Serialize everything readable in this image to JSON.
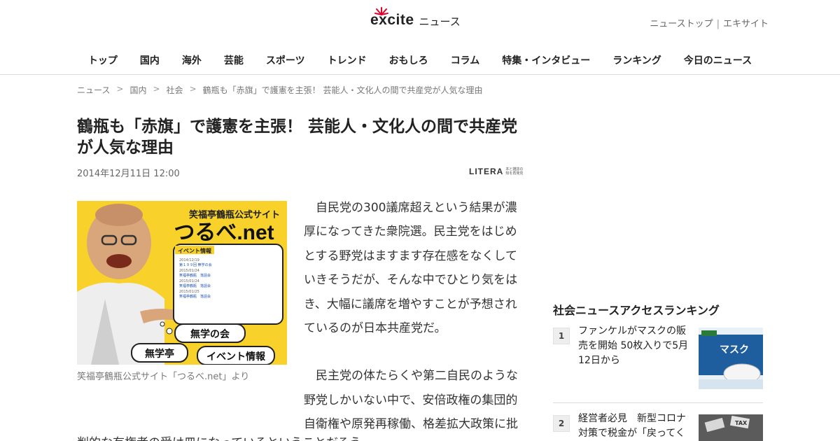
{
  "header": {
    "logo_text": "excite",
    "logo_suffix": "ニュース",
    "links": [
      "ニューストップ",
      "エキサイト"
    ],
    "link_separator": "|"
  },
  "nav": {
    "items": [
      "トップ",
      "国内",
      "海外",
      "芸能",
      "スポーツ",
      "トレンド",
      "おもしろ",
      "コラム",
      "特集・インタビュー",
      "ランキング",
      "今日のニュース"
    ]
  },
  "breadcrumb": {
    "items": [
      "ニュース",
      "国内",
      "社会",
      "鶴瓶も「赤旗」で護憲を主張！ 芸能人・文化人の間で共産党が人気な理由"
    ],
    "separator": ">"
  },
  "article": {
    "title": "鶴瓶も「赤旗」で護憲を主張！ 芸能人・文化人の間で共産党が人気な理由",
    "date": "2014年12月11日 12:00",
    "source": "LITERA",
    "source_tagline": "本と雑誌の知を再発見",
    "image": {
      "site_name": "笑福亭鶴瓶公式サイト",
      "site_title": "つるべ.net",
      "panel_label": "イベント情報",
      "events": [
        {
          "date": "2014/12/19",
          "name": "第１９９回 無学の会"
        },
        {
          "date": "2015/01/24",
          "name": "笑福亭鶴瓶　落語会"
        },
        {
          "date": "2015/01/24",
          "name": "笑福亭鶴瓶　落語会"
        },
        {
          "date": "2015/01/25",
          "name": "笑福亭鶴瓶　落語会"
        }
      ],
      "bubbles": [
        "無学の会",
        "無学亭",
        "イベント情報"
      ]
    },
    "caption": "笑福亭鶴瓶公式サイト「つるべ.net」より",
    "paragraphs": [
      "自民党の300議席超えという結果が濃厚になってきた衆院選。民主党をはじめとする野党はますます存在感をなくしていきそうだが、そんな中でひとり気をはき、大幅に議席を増やすことが予想されているのが日本共産党だ。",
      "民主党の体たらくや第二自民のような野党しかいない中で、安倍政権の集団的自衛権や原発再稼働、格差拡大政策に批"
    ],
    "cutoff_line": "判的な有権者の受け皿になっているということだろう。"
  },
  "sidebar": {
    "ranking_title": "社会ニュースアクセスランキング",
    "items": [
      {
        "rank": "1",
        "text": "ファンケルがマスクの販売を開始 50枚入りで5月12日から",
        "thumb_text": "マスク"
      },
      {
        "rank": "2",
        "text": "経営者必見　新型コロナ対策で税金が「戻ってく",
        "thumb_text": "TAX"
      }
    ]
  },
  "colors": {
    "accent_red": "#e4002b",
    "photo_yellow": "#f8d22a",
    "text": "#222222"
  }
}
